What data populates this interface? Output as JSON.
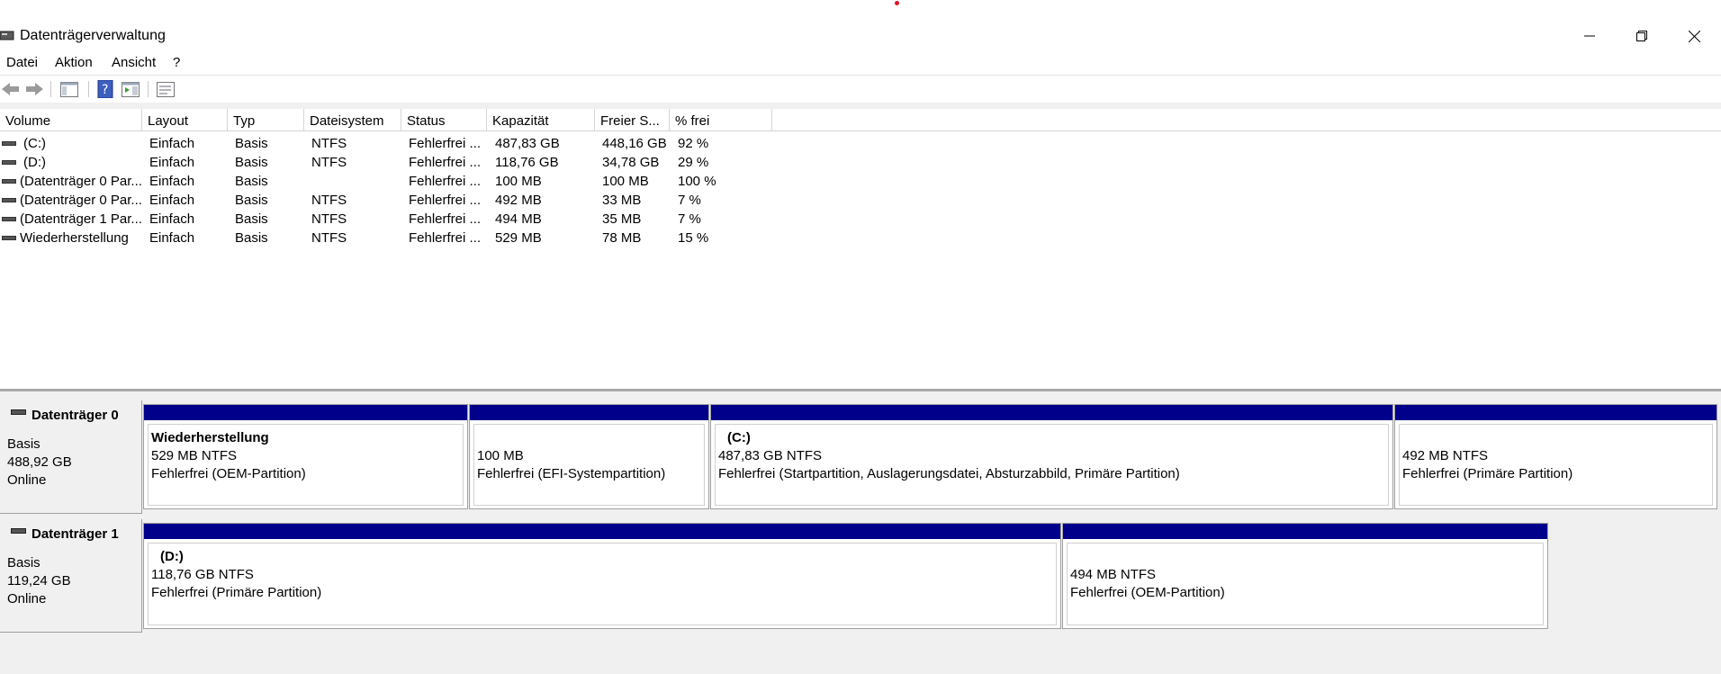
{
  "window": {
    "title": "Datenträgerverwaltung"
  },
  "menu": [
    "Datei",
    "Aktion",
    "Ansicht",
    "?"
  ],
  "toolbar": {
    "icons": [
      "back-arrow-icon",
      "forward-arrow-icon",
      "console-tree-icon",
      "help-icon",
      "action-pane-icon",
      "properties-icon"
    ]
  },
  "volume_list": {
    "headers": [
      "Volume",
      "Layout",
      "Typ",
      "Dateisystem",
      "Status",
      "Kapazität",
      "Freier S...",
      "% frei"
    ],
    "rows": [
      [
        "(C:)",
        "Einfach",
        "Basis",
        "NTFS",
        "Fehlerfrei ...",
        "487,83 GB",
        "448,16 GB",
        "92 %"
      ],
      [
        "(D:)",
        "Einfach",
        "Basis",
        "NTFS",
        "Fehlerfrei ...",
        "118,76 GB",
        "34,78 GB",
        "29 %"
      ],
      [
        "(Datenträger 0 Par...",
        "Einfach",
        "Basis",
        "",
        "Fehlerfrei ...",
        "100 MB",
        "100 MB",
        "100 %"
      ],
      [
        "(Datenträger 0 Par...",
        "Einfach",
        "Basis",
        "NTFS",
        "Fehlerfrei ...",
        "492 MB",
        "33 MB",
        "7 %"
      ],
      [
        "(Datenträger 1 Par...",
        "Einfach",
        "Basis",
        "NTFS",
        "Fehlerfrei ...",
        "494 MB",
        "35 MB",
        "7 %"
      ],
      [
        "Wiederherstellung",
        "Einfach",
        "Basis",
        "NTFS",
        "Fehlerfrei ...",
        "529 MB",
        "78 MB",
        "15 %"
      ]
    ]
  },
  "disks": [
    {
      "name": "Datenträger 0",
      "type": "Basis",
      "size": "488,92 GB",
      "state": "Online",
      "partitions": [
        {
          "title": "Wiederherstellung",
          "size": "529 MB NTFS",
          "status": "Fehlerfrei (OEM-Partition)"
        },
        {
          "title": "",
          "size": "100 MB",
          "status": "Fehlerfrei (EFI-Systempartition)"
        },
        {
          "title": "(C:)",
          "size": "487,83 GB NTFS",
          "status": "Fehlerfrei (Startpartition, Auslagerungsdatei, Absturzabbild, Primäre Partition)"
        },
        {
          "title": "",
          "size": "492 MB NTFS",
          "status": "Fehlerfrei (Primäre Partition)"
        }
      ]
    },
    {
      "name": "Datenträger 1",
      "type": "Basis",
      "size": "119,24 GB",
      "state": "Online",
      "partitions": [
        {
          "title": "(D:)",
          "size": "118,76 GB NTFS",
          "status": "Fehlerfrei (Primäre Partition)"
        },
        {
          "title": "",
          "size": "494 MB NTFS",
          "status": "Fehlerfrei (OEM-Partition)"
        }
      ]
    }
  ],
  "colors": {
    "partition_bar": "#00008b",
    "window_bg": "#f0f0f0"
  }
}
